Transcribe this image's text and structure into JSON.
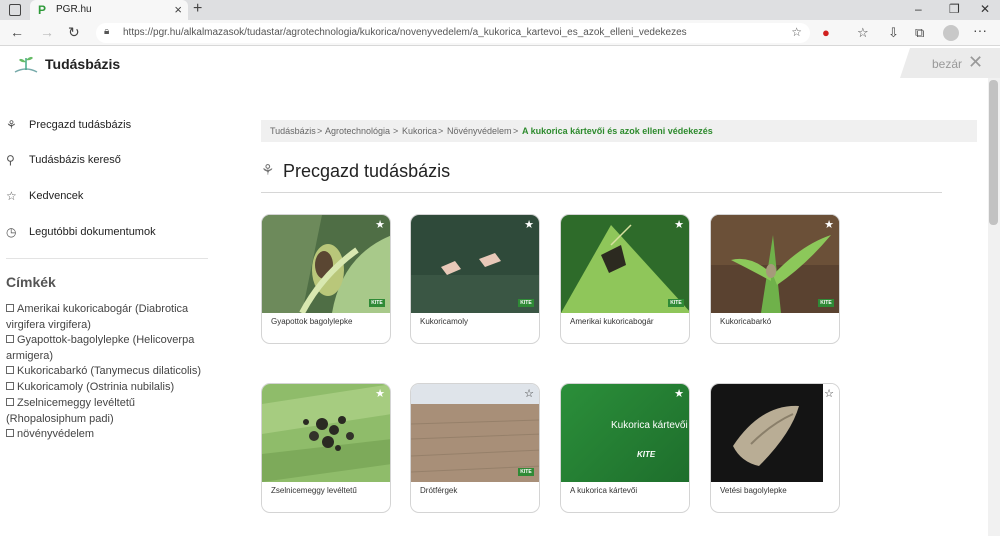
{
  "browser": {
    "tab_title": "PGR.hu",
    "url": "https://pgr.hu/alkalmazasok/tudastar/agrotechnologia/kukorica/novenyvedelem/a_kukorica_kartevoi_es_azok_elleni_vedekezes"
  },
  "site": {
    "brand": "Tudásbázis",
    "close_label": "bezár"
  },
  "sidebar": {
    "items": [
      {
        "label": "Precgazd tudásbázis",
        "icon": "precgazd-icon"
      },
      {
        "label": "Tudásbázis kereső",
        "icon": "search-icon"
      },
      {
        "label": "Kedvencek",
        "icon": "star-icon"
      },
      {
        "label": "Legutóbbi dokumentumok",
        "icon": "history-icon"
      }
    ],
    "tags_title": "Címkék",
    "tags": [
      "Amerikai kukoricabogár (Diabrotica virgifera virgifera)",
      "Gyapottok-bagolylepke (Helicoverpa armigera)",
      "Kukoricabarkó (Tanymecus dilaticolis)",
      "Kukoricamoly (Ostrinia nubilalis)",
      "Zselnicemeggy levéltetű (Rhopalosiphum padi)",
      "növényvédelem"
    ]
  },
  "breadcrumb": {
    "items": [
      "Tudásbázis",
      ">",
      "Agrotechnológia",
      ">",
      "Kukorica",
      ">",
      "Növényvédelem",
      ">"
    ],
    "current": "A kukorica kártevői és azok elleni védekezés"
  },
  "page_title": "Precgazd tudásbázis",
  "cards": [
    {
      "caption": "Gyapottok bagolylepke",
      "image": "green-corn-ear"
    },
    {
      "caption": "Kukoricamoly",
      "image": "two-moths-on-dark-green"
    },
    {
      "caption": "Amerikai kukoricabogár",
      "image": "beetle-on-leaf"
    },
    {
      "caption": "Kukoricabarkó",
      "image": "weevil-on-seedling"
    },
    {
      "caption": "Zselnicemeggy levéltetű",
      "image": "aphids-on-leaf"
    },
    {
      "caption": "Drótférgek",
      "image": "plowed-field"
    },
    {
      "caption": "A kukorica kártevői",
      "image": "green-title-slide",
      "slide_title": "Kukorica kártevői",
      "slide_logo": "KITE"
    },
    {
      "caption": "Vetési bagolylepke",
      "image": "moth-on-black"
    }
  ],
  "kite_badge": "KITE",
  "colors": {
    "brand_green": "#2e8b2e",
    "breadcrumb_bg": "#f0f0f0"
  }
}
